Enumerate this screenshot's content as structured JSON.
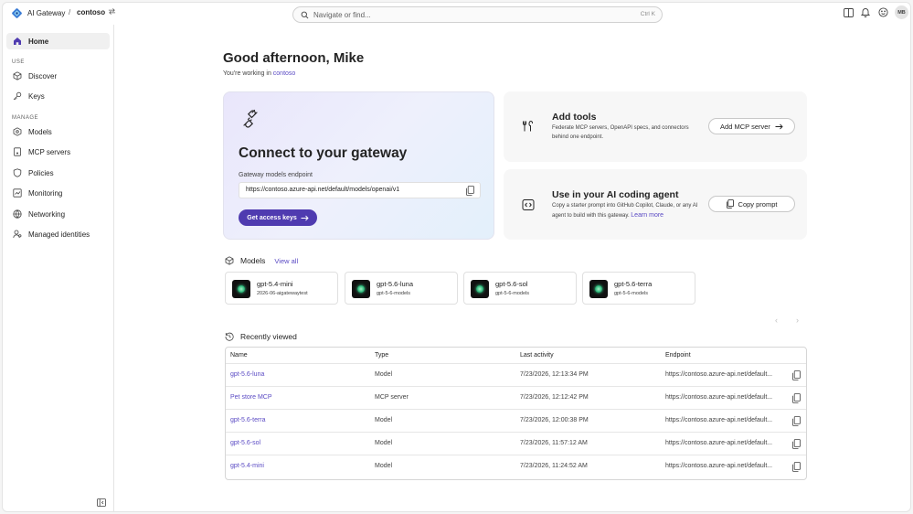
{
  "topbar": {
    "brand_name": "AI Gateway",
    "separator": "/",
    "tenant": "contoso",
    "search_placeholder": "Navigate or find...",
    "search_shortcut": "Ctrl K",
    "avatar_initials": "MB",
    "icons": [
      "ai-gateway-logo-icon",
      "switch-tenant-icon",
      "search-icon",
      "panel-icon",
      "bell-icon",
      "smiley-icon"
    ]
  },
  "sidebar": {
    "home_label": "Home",
    "use_heading": "USE",
    "manage_heading": "MANAGE",
    "items": [
      {
        "label": "Discover"
      },
      {
        "label": "Keys"
      },
      {
        "label": "Models"
      },
      {
        "label": "MCP servers"
      },
      {
        "label": "Policies"
      },
      {
        "label": "Monitoring"
      },
      {
        "label": "Networking"
      },
      {
        "label": "Managed identities"
      }
    ]
  },
  "main": {
    "greeting": "Good afternoon, Mike",
    "workspace_prefix": "You're working in ",
    "workspace_name": "contoso",
    "hero": {
      "title": "Connect to your gateway",
      "endpoint_label": "Gateway models endpoint",
      "endpoint_value": "https://contoso.azure-api.net/default/models/openai/v1",
      "button_label": "Get access keys"
    },
    "add_tools": {
      "title": "Add tools",
      "description": "Federate MCP servers, OpenAPI specs, and connectors behind one endpoint.",
      "button_label": "Add MCP server"
    },
    "coding_agent": {
      "title": "Use in your AI coding agent",
      "description": "Copy a starter prompt into GitHub Copilot, Claude, or any AI agent to build with this gateway.",
      "link_label": "Learn more",
      "button_label": "Copy prompt"
    },
    "models_section": {
      "title": "Models",
      "view_all": "View all",
      "cards": [
        {
          "name": "gpt-5.4-mini",
          "deployment": "2026-06-aigatewaytest"
        },
        {
          "name": "gpt-5.6-luna",
          "deployment": "gpt-5-6-models"
        },
        {
          "name": "gpt-5.6-sol",
          "deployment": "gpt-5-6-models"
        },
        {
          "name": "gpt-5.6-terra",
          "deployment": "gpt-5-6-models"
        }
      ],
      "pager_prev": "‹",
      "pager_next": "›"
    },
    "recent_section": {
      "title": "Recently viewed",
      "columns": [
        "Name",
        "Type",
        "Last activity",
        "Endpoint"
      ],
      "rows": [
        {
          "name": "gpt-5.6-luna",
          "type": "Model",
          "activity": "7/23/2026, 12:13:34 PM",
          "endpoint": "https://contoso.azure-api.net/default..."
        },
        {
          "name": "Pet store MCP",
          "type": "MCP server",
          "activity": "7/23/2026, 12:12:42 PM",
          "endpoint": "https://contoso.azure-api.net/default..."
        },
        {
          "name": "gpt-5.6-terra",
          "type": "Model",
          "activity": "7/23/2026, 12:00:38 PM",
          "endpoint": "https://contoso.azure-api.net/default..."
        },
        {
          "name": "gpt-5.6-sol",
          "type": "Model",
          "activity": "7/23/2026, 11:57:12 AM",
          "endpoint": "https://contoso.azure-api.net/default..."
        },
        {
          "name": "gpt-5.4-mini",
          "type": "Model",
          "activity": "7/23/2026, 11:24:52 AM",
          "endpoint": "https://contoso.azure-api.net/default..."
        }
      ]
    }
  },
  "colors": {
    "accent": "#4f3bb0",
    "link": "#5b4bc4",
    "text": "#242424"
  }
}
